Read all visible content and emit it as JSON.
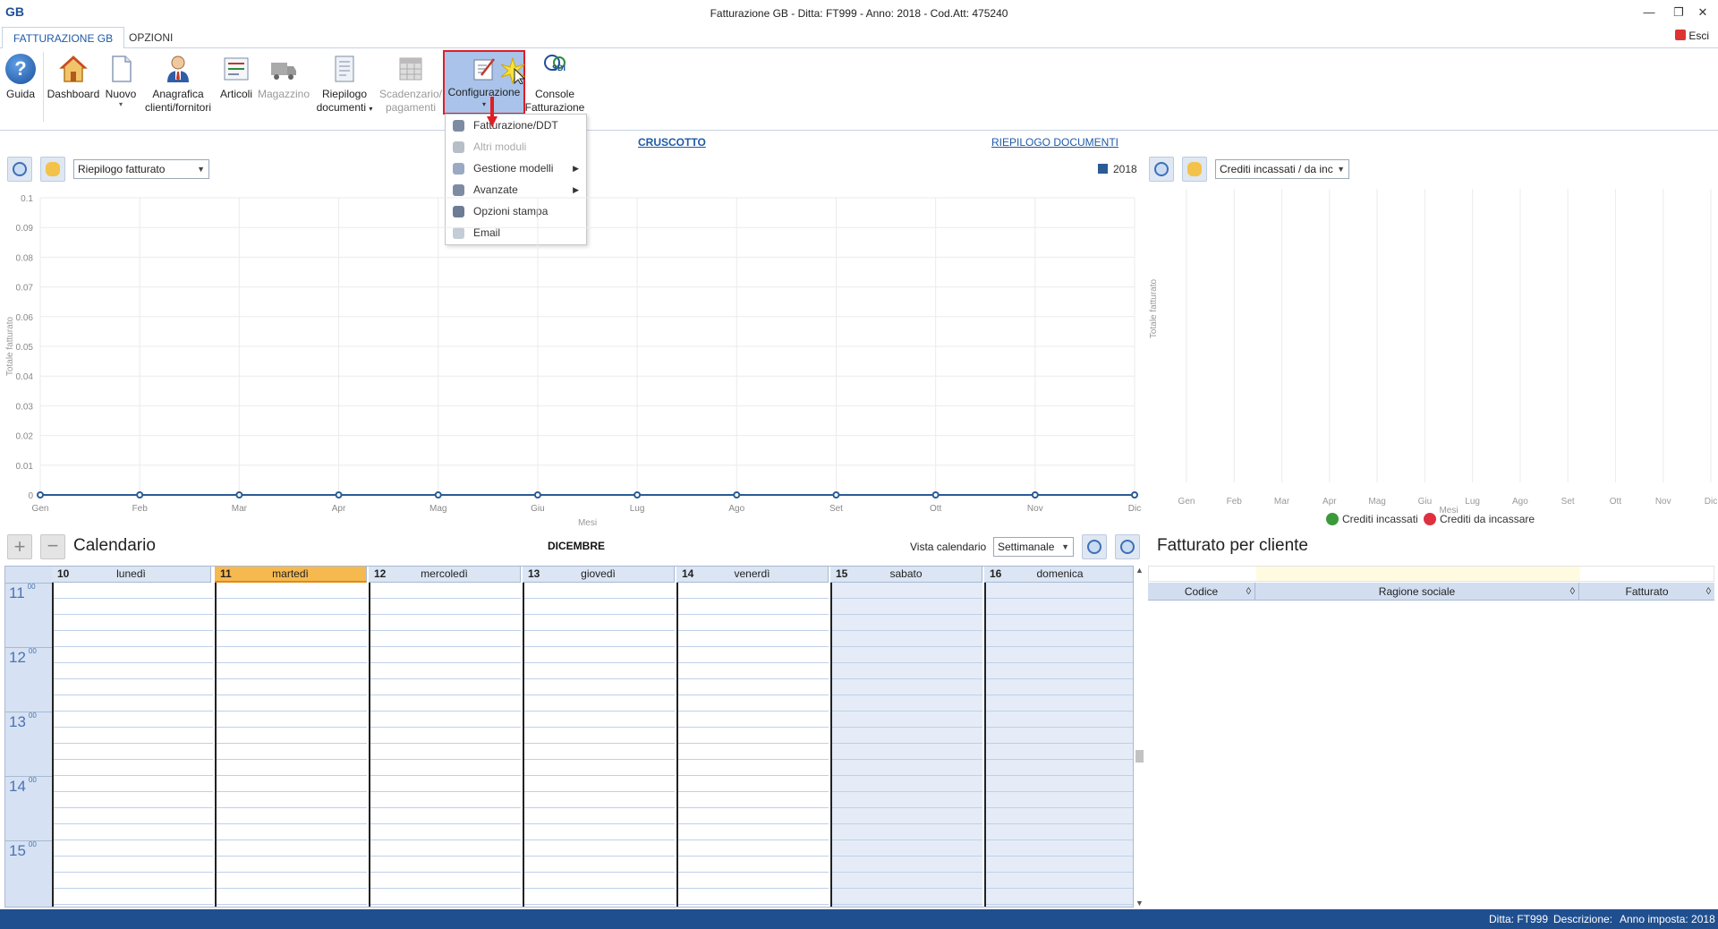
{
  "titlebar": {
    "logo_text": "GB",
    "title": "Fatturazione GB - Ditta: FT999 - Anno: 2018 - Cod.Att: 475240",
    "minimize": "—",
    "restore": "❐",
    "close": "✕"
  },
  "tabs": [
    {
      "label": "FATTURAZIONE GB",
      "active": true
    },
    {
      "label": "OPZIONI",
      "active": false
    }
  ],
  "esci_label": "Esci",
  "ribbon": {
    "guida": "Guida",
    "dashboard": "Dashboard",
    "nuovo": "Nuovo",
    "anagrafica_l1": "Anagrafica",
    "anagrafica_l2": "clienti/fornitori",
    "articoli": "Articoli",
    "magazzino": "Magazzino",
    "riepilogo_l1": "Riepilogo",
    "riepilogo_l2": "documenti",
    "scadenzario_l1": "Scadenzario/",
    "scadenzario_l2": "pagamenti",
    "configurazione": "Configurazione",
    "console_badge": "SDI",
    "console_l1": "Console",
    "console_l2": "Fatturazione",
    "arrow": "▾"
  },
  "config_menu": [
    {
      "label": "Fatturazione/DDT",
      "disabled": false,
      "submenu": false,
      "icon": "gear-icon"
    },
    {
      "label": "Altri moduli",
      "disabled": true,
      "submenu": false,
      "icon": "modules-icon"
    },
    {
      "label": "Gestione modelli",
      "disabled": false,
      "submenu": true,
      "icon": "document-icon"
    },
    {
      "label": "Avanzate",
      "disabled": false,
      "submenu": true,
      "icon": "gear-icon"
    },
    {
      "label": "Opzioni stampa",
      "disabled": false,
      "submenu": false,
      "icon": "printer-icon"
    },
    {
      "label": "Email",
      "disabled": false,
      "submenu": false,
      "icon": "mail-icon"
    }
  ],
  "links": {
    "cruscotto": "CRUSCOTTO",
    "riepilogo_documenti": "RIEPILOGO DOCUMENTI"
  },
  "left_chart_select": "Riepilogo fatturato",
  "right_chart_select": "Crediti incassati / da inc",
  "chart_data": [
    {
      "type": "line",
      "x": [
        "Gen",
        "Feb",
        "Mar",
        "Apr",
        "Mag",
        "Giu",
        "Lug",
        "Ago",
        "Set",
        "Ott",
        "Nov",
        "Dic"
      ],
      "series": [
        {
          "name": "2018",
          "values": [
            0,
            0,
            0,
            0,
            0,
            0,
            0,
            0,
            0,
            0,
            0,
            0
          ],
          "color": "#2a5b94"
        }
      ],
      "xlabel": "Mesi",
      "ylabel": "Totale fatturato",
      "ylim": [
        0,
        0.1
      ],
      "yticks": [
        "0",
        "0.01",
        "0.02",
        "0.03",
        "0.04",
        "0.05",
        "0.06",
        "0.07",
        "0.08",
        "0.09",
        "0.1"
      ],
      "grid": true,
      "legend": "top-right"
    },
    {
      "type": "bar",
      "categories": [
        "Gen",
        "Feb",
        "Mar",
        "Apr",
        "Mag",
        "Giu",
        "Lug",
        "Ago",
        "Set",
        "Ott",
        "Nov",
        "Dic"
      ],
      "series": [
        {
          "name": "Crediti incassati",
          "values": [
            0,
            0,
            0,
            0,
            0,
            0,
            0,
            0,
            0,
            0,
            0,
            0
          ],
          "color": "#3a9a3a"
        },
        {
          "name": "Crediti da incassare",
          "values": [
            0,
            0,
            0,
            0,
            0,
            0,
            0,
            0,
            0,
            0,
            0,
            0
          ],
          "color": "#e03040"
        }
      ],
      "xlabel": "Mesi",
      "ylabel": "Totale fatturato",
      "grid": true,
      "legend": "bottom"
    }
  ],
  "calendar": {
    "title": "Calendario",
    "month": "DICEMBRE",
    "vista_label": "Vista calendario",
    "vista_value": "Settimanale",
    "days": [
      {
        "num": "10",
        "name": "lunedì",
        "today": false,
        "weekend": false
      },
      {
        "num": "11",
        "name": "martedì",
        "today": true,
        "weekend": false
      },
      {
        "num": "12",
        "name": "mercoledì",
        "today": false,
        "weekend": false
      },
      {
        "num": "13",
        "name": "giovedì",
        "today": false,
        "weekend": false
      },
      {
        "num": "14",
        "name": "venerdì",
        "today": false,
        "weekend": false
      },
      {
        "num": "15",
        "name": "sabato",
        "today": false,
        "weekend": true
      },
      {
        "num": "16",
        "name": "domenica",
        "today": false,
        "weekend": true
      }
    ],
    "hours": [
      "11",
      "12",
      "13",
      "14",
      "15"
    ],
    "minutes": "00"
  },
  "fatturato_cliente": {
    "title": "Fatturato per cliente",
    "columns": [
      "Codice",
      "Ragione sociale",
      "Fatturato"
    ],
    "sort_icon": "◊"
  },
  "statusbar": {
    "ditta": "Ditta: FT999",
    "descrizione": "Descrizione:",
    "anno": "Anno imposta: 2018"
  }
}
